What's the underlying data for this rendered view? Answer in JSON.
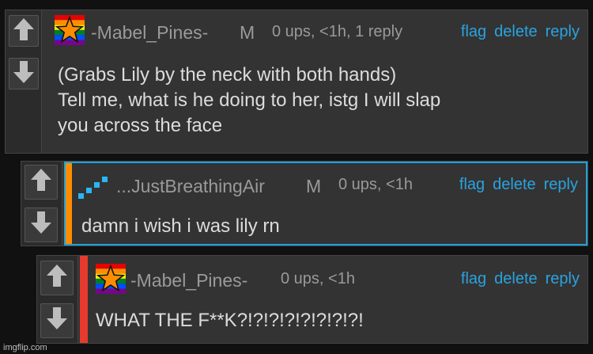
{
  "colors": {
    "link": "#2aa3e0",
    "reply_bar_orange": "#ff8c00",
    "reply_bar_red": "#e63a2e",
    "highlight_border": "#1fa3d9"
  },
  "icons": {
    "upvote": "up-arrow-icon",
    "downvote": "down-arrow-icon",
    "pride_star_avatar": "rainbow-star-icon",
    "blue_steps_avatar": "blue-steps-icon"
  },
  "comments": [
    {
      "username": "-Mabel_Pines-",
      "mod": "M",
      "meta": "0 ups, <1h, 1 reply",
      "actions": [
        "flag",
        "delete",
        "reply"
      ],
      "text": "(Grabs Lily by the neck with both hands)\nTell me, what is he doing to her, istg I will slap\nyou across the face"
    },
    {
      "username": "...JustBreathingAir",
      "mod": "M",
      "meta": "0 ups, <1h",
      "actions": [
        "flag",
        "delete",
        "reply"
      ],
      "text": "damn i wish i was lily rn"
    },
    {
      "username": "-Mabel_Pines-",
      "mod": "",
      "meta": "0 ups, <1h",
      "actions": [
        "flag",
        "delete",
        "reply"
      ],
      "text": "WHAT THE F**K?!?!?!?!?!?!?!?!"
    }
  ],
  "watermark": "imgflip.com"
}
